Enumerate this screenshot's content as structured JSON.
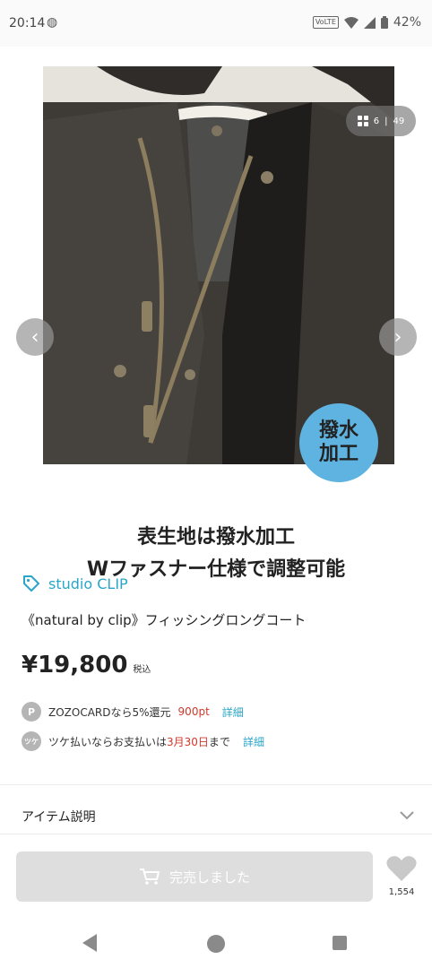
{
  "status_bar": {
    "time": "20:14",
    "network": "VoLTE",
    "battery": "42%"
  },
  "gallery": {
    "counter_current": "6",
    "counter_separator": "|",
    "counter_total": "49",
    "badge_line1": "撥水",
    "badge_line2": "加工",
    "caption_line1": "表生地は撥水加工",
    "caption_line2": "Wファスナー仕様で調整可能"
  },
  "product": {
    "brand": "studio CLIP",
    "title": "《natural by clip》フィッシングロングコート",
    "price": "¥19,800",
    "tax_label": "税込",
    "points": {
      "icon_letter": "P",
      "text": "ZOZOCARDなら5%還元",
      "amount": "900pt",
      "link": "詳細"
    },
    "tsuke": {
      "icon_letter": "ツケ",
      "text_before": "ツケ払いならお支払いは",
      "date": "3月30日",
      "text_after": "まで",
      "link": "詳細"
    },
    "section_label": "アイテム説明"
  },
  "actions": {
    "soldout_label": "完売しました",
    "favorite_count": "1,554"
  },
  "colors": {
    "accent": "#2aa6c9",
    "badge": "#5fb3e0",
    "price_red": "#d0382c",
    "soldout_bg": "#dedede"
  },
  "icons": {
    "brand": "tag-icon",
    "cart": "cart-icon",
    "favorite": "heart-icon",
    "expand": "chevron-down-icon"
  }
}
